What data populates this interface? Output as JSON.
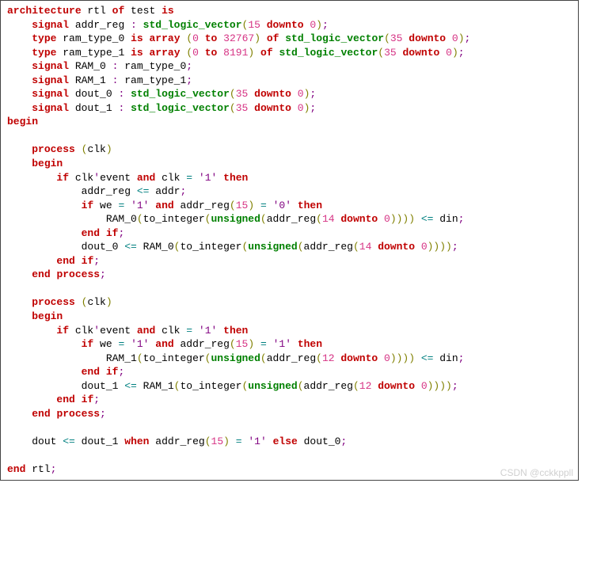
{
  "code": {
    "l1": {
      "kw1": "architecture",
      "id1": " rtl ",
      "kw2": "of",
      "id2": " test ",
      "kw3": "is"
    },
    "l2": {
      "indent": "    ",
      "kw": "signal",
      "id": " addr_reg ",
      "colon": ":",
      "sp": " ",
      "type": "std_logic_vector",
      "p1": "(",
      "n1": "15",
      "sp2": " ",
      "kw2": "downto",
      "sp3": " ",
      "n2": "0",
      "p2": ")",
      "semi": ";"
    },
    "l3": {
      "indent": "    ",
      "kw": "type",
      "id": " ram_type_0 ",
      "kw2": "is",
      "sp": " ",
      "kw3": "array",
      "sp2": " ",
      "p1": "(",
      "n1": "0",
      "sp3": " ",
      "kw4": "to",
      "sp4": " ",
      "n2": "32767",
      "p2": ")",
      "sp5": " ",
      "kw5": "of",
      "sp6": " ",
      "type": "std_logic_vector",
      "p3": "(",
      "n3": "35",
      "sp7": " ",
      "kw6": "downto",
      "sp8": " ",
      "n4": "0",
      "p4": ")",
      "semi": ";"
    },
    "l4": {
      "indent": "    ",
      "kw": "type",
      "id": " ram_type_1 ",
      "kw2": "is",
      "sp": " ",
      "kw3": "array",
      "sp2": " ",
      "p1": "(",
      "n1": "0",
      "sp3": " ",
      "kw4": "to",
      "sp4": " ",
      "n2": "8191",
      "p2": ")",
      "sp5": " ",
      "kw5": "of",
      "sp6": " ",
      "type": "std_logic_vector",
      "p3": "(",
      "n3": "35",
      "sp7": " ",
      "kw6": "downto",
      "sp8": " ",
      "n4": "0",
      "p4": ")",
      "semi": ";"
    },
    "l5": {
      "indent": "    ",
      "kw": "signal",
      "id": " RAM_0 ",
      "colon": ":",
      "id2": " ram_type_0",
      "semi": ";"
    },
    "l6": {
      "indent": "    ",
      "kw": "signal",
      "id": " RAM_1 ",
      "colon": ":",
      "id2": " ram_type_1",
      "semi": ";"
    },
    "l7": {
      "indent": "    ",
      "kw": "signal",
      "id": " dout_0 ",
      "colon": ":",
      "sp": " ",
      "type": "std_logic_vector",
      "p1": "(",
      "n1": "35",
      "sp2": " ",
      "kw2": "downto",
      "sp3": " ",
      "n2": "0",
      "p2": ")",
      "semi": ";"
    },
    "l8": {
      "indent": "    ",
      "kw": "signal",
      "id": " dout_1 ",
      "colon": ":",
      "sp": " ",
      "type": "std_logic_vector",
      "p1": "(",
      "n1": "35",
      "sp2": " ",
      "kw2": "downto",
      "sp3": " ",
      "n2": "0",
      "p2": ")",
      "semi": ";"
    },
    "l9": {
      "kw": "begin"
    },
    "l10": {
      "txt": " "
    },
    "l11": {
      "indent": "    ",
      "kw": "process",
      "sp": " ",
      "p1": "(",
      "id": "clk",
      "p2": ")"
    },
    "l12": {
      "indent": "    ",
      "kw": "begin"
    },
    "l13": {
      "indent": "        ",
      "kw": "if",
      "id": " clk",
      "tick": "'",
      "attr": "event ",
      "kw2": "and",
      "id2": " clk ",
      "op": "=",
      "sp": " ",
      "str": "'1'",
      "sp2": " ",
      "kw3": "then"
    },
    "l14": {
      "indent": "            ",
      "id": "addr_reg ",
      "op": "<=",
      "id2": " addr",
      "semi": ";"
    },
    "l15": {
      "indent": "            ",
      "kw": "if",
      "id": " we ",
      "op": "=",
      "sp": " ",
      "str": "'1'",
      "sp2": " ",
      "kw2": "and",
      "id2": " addr_reg",
      "p1": "(",
      "n1": "15",
      "p2": ")",
      "sp3": " ",
      "op2": "=",
      "sp4": " ",
      "str2": "'0'",
      "sp5": " ",
      "kw3": "then"
    },
    "l16": {
      "indent": "                ",
      "id": "RAM_0",
      "p1": "(",
      "id2": "to_integer",
      "p2": "(",
      "fn": "unsigned",
      "p3": "(",
      "id3": "addr_reg",
      "p4": "(",
      "n1": "14",
      "sp": " ",
      "kw": "downto",
      "sp2": " ",
      "n2": "0",
      "p5": "))))",
      "sp3": " ",
      "op": "<=",
      "id4": " din",
      "semi": ";"
    },
    "l17": {
      "indent": "            ",
      "kw": "end",
      "sp": " ",
      "kw2": "if",
      "semi": ";"
    },
    "l18": {
      "indent": "            ",
      "id": "dout_0 ",
      "op": "<=",
      "id2": " RAM_0",
      "p1": "(",
      "id3": "to_integer",
      "p2": "(",
      "fn": "unsigned",
      "p3": "(",
      "id4": "addr_reg",
      "p4": "(",
      "n1": "14",
      "sp": " ",
      "kw": "downto",
      "sp2": " ",
      "n2": "0",
      "p5": "))))",
      "semi": ";"
    },
    "l19": {
      "indent": "        ",
      "kw": "end",
      "sp": " ",
      "kw2": "if",
      "semi": ";"
    },
    "l20": {
      "indent": "    ",
      "kw": "end",
      "sp": " ",
      "kw2": "process",
      "semi": ";"
    },
    "l21": {
      "txt": " "
    },
    "l22": {
      "indent": "    ",
      "kw": "process",
      "sp": " ",
      "p1": "(",
      "id": "clk",
      "p2": ")"
    },
    "l23": {
      "indent": "    ",
      "kw": "begin"
    },
    "l24": {
      "indent": "        ",
      "kw": "if",
      "id": " clk",
      "tick": "'",
      "attr": "event ",
      "kw2": "and",
      "id2": " clk ",
      "op": "=",
      "sp": " ",
      "str": "'1'",
      "sp2": " ",
      "kw3": "then"
    },
    "l25": {
      "indent": "            ",
      "kw": "if",
      "id": " we ",
      "op": "=",
      "sp": " ",
      "str": "'1'",
      "sp2": " ",
      "kw2": "and",
      "id2": " addr_reg",
      "p1": "(",
      "n1": "15",
      "p2": ")",
      "sp3": " ",
      "op2": "=",
      "sp4": " ",
      "str2": "'1'",
      "sp5": " ",
      "kw3": "then"
    },
    "l26": {
      "indent": "                ",
      "id": "RAM_1",
      "p1": "(",
      "id2": "to_integer",
      "p2": "(",
      "fn": "unsigned",
      "p3": "(",
      "id3": "addr_reg",
      "p4": "(",
      "n1": "12",
      "sp": " ",
      "kw": "downto",
      "sp2": " ",
      "n2": "0",
      "p5": "))))",
      "sp3": " ",
      "op": "<=",
      "id4": " din",
      "semi": ";"
    },
    "l27": {
      "indent": "            ",
      "kw": "end",
      "sp": " ",
      "kw2": "if",
      "semi": ";"
    },
    "l28": {
      "indent": "            ",
      "id": "dout_1 ",
      "op": "<=",
      "id2": " RAM_1",
      "p1": "(",
      "id3": "to_integer",
      "p2": "(",
      "fn": "unsigned",
      "p3": "(",
      "id4": "addr_reg",
      "p4": "(",
      "n1": "12",
      "sp": " ",
      "kw": "downto",
      "sp2": " ",
      "n2": "0",
      "p5": "))))",
      "semi": ";"
    },
    "l29": {
      "indent": "        ",
      "kw": "end",
      "sp": " ",
      "kw2": "if",
      "semi": ";"
    },
    "l30": {
      "indent": "    ",
      "kw": "end",
      "sp": " ",
      "kw2": "process",
      "semi": ";"
    },
    "l31": {
      "txt": " "
    },
    "l32": {
      "indent": "    ",
      "id": "dout ",
      "op": "<=",
      "id2": " dout_1 ",
      "kw": "when",
      "id3": " addr_reg",
      "p1": "(",
      "n1": "15",
      "p2": ")",
      "sp": " ",
      "op2": "=",
      "sp2": " ",
      "str": "'1'",
      "sp3": " ",
      "kw2": "else",
      "id4": " dout_0",
      "semi": ";"
    },
    "l33": {
      "txt": " "
    },
    "l34": {
      "kw": "end",
      "id": " rtl",
      "semi": ";"
    }
  },
  "watermark": "CSDN @cckkppll"
}
